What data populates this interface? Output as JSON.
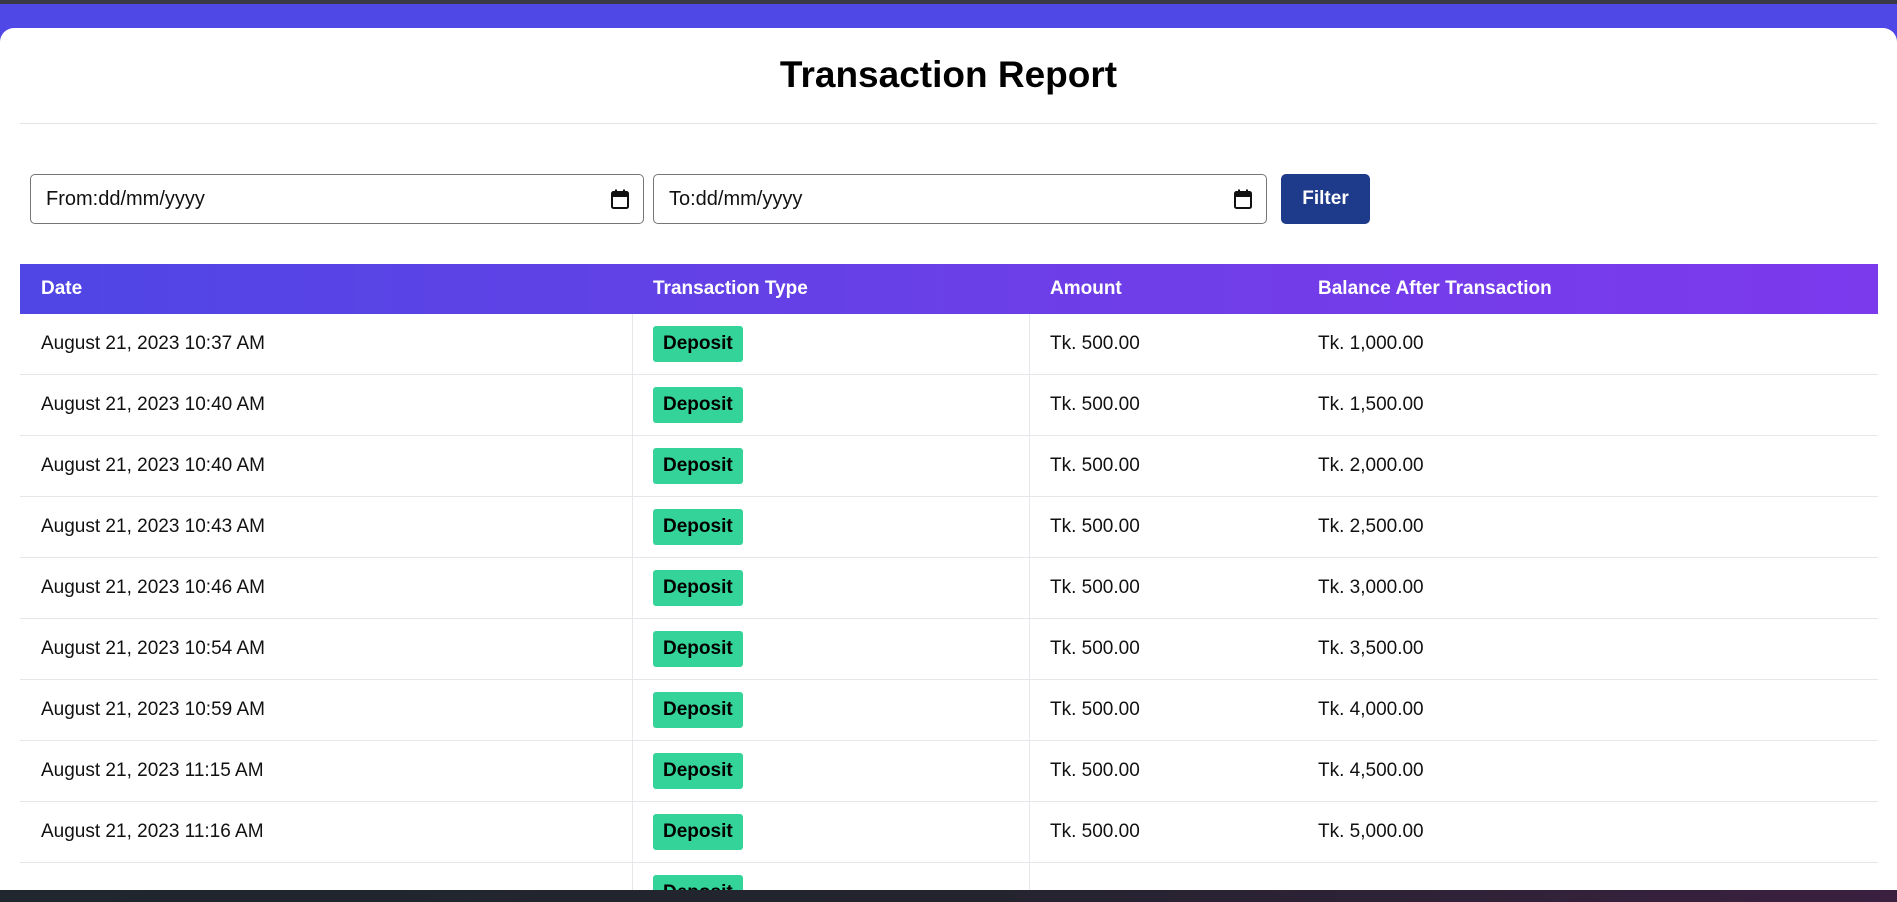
{
  "page": {
    "title": "Transaction Report"
  },
  "filters": {
    "from_text": "From:dd/mm/yyyy",
    "to_text": "To:dd/mm/yyyy",
    "filter_label": "Filter"
  },
  "table": {
    "headers": [
      "Date",
      "Transaction Type",
      "Amount",
      "Balance After Transaction"
    ],
    "rows": [
      {
        "date": "August 21, 2023 10:37 AM",
        "type": "Deposit",
        "amount": "Tk. 500.00",
        "balance": "Tk. 1,000.00"
      },
      {
        "date": "August 21, 2023 10:40 AM",
        "type": "Deposit",
        "amount": "Tk. 500.00",
        "balance": "Tk. 1,500.00"
      },
      {
        "date": "August 21, 2023 10:40 AM",
        "type": "Deposit",
        "amount": "Tk. 500.00",
        "balance": "Tk. 2,000.00"
      },
      {
        "date": "August 21, 2023 10:43 AM",
        "type": "Deposit",
        "amount": "Tk. 500.00",
        "balance": "Tk. 2,500.00"
      },
      {
        "date": "August 21, 2023 10:46 AM",
        "type": "Deposit",
        "amount": "Tk. 500.00",
        "balance": "Tk. 3,000.00"
      },
      {
        "date": "August 21, 2023 10:54 AM",
        "type": "Deposit",
        "amount": "Tk. 500.00",
        "balance": "Tk. 3,500.00"
      },
      {
        "date": "August 21, 2023 10:59 AM",
        "type": "Deposit",
        "amount": "Tk. 500.00",
        "balance": "Tk. 4,000.00"
      },
      {
        "date": "August 21, 2023 11:15 AM",
        "type": "Deposit",
        "amount": "Tk. 500.00",
        "balance": "Tk. 4,500.00"
      },
      {
        "date": "August 21, 2023 11:16 AM",
        "type": "Deposit",
        "amount": "Tk. 500.00",
        "balance": "Tk. 5,000.00"
      },
      {
        "date": "",
        "type": "Deposit",
        "amount": "",
        "balance": ""
      }
    ]
  },
  "colors": {
    "header_gradient_start": "#4f46e5",
    "header_gradient_end": "#7c3aed",
    "deposit_badge": "#34d399",
    "filter_button": "#1e3a8a"
  },
  "icons": {
    "date_picker": "calendar-icon"
  }
}
